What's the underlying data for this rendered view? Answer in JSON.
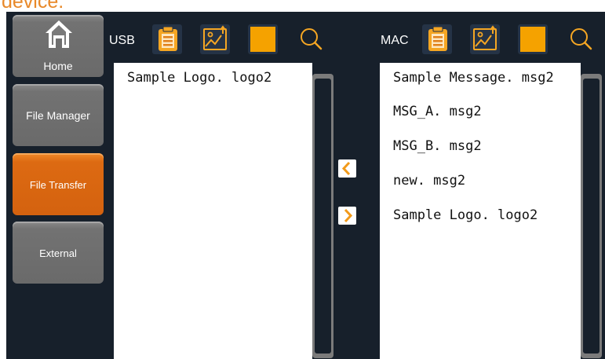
{
  "top_clipped_text": "device.",
  "nav": {
    "home": {
      "label": "Home",
      "icon": "home-icon"
    },
    "file_manager": {
      "label": "File Manager"
    },
    "file_transfer": {
      "label": "File Transfer",
      "active": true
    },
    "external": {
      "label": "External"
    }
  },
  "usb": {
    "label": "USB",
    "toolbar": [
      "message-list-icon",
      "logo-image-icon",
      "select-all-square-icon",
      "search-icon"
    ],
    "files": [
      "Sample Logo. logo2"
    ]
  },
  "mac": {
    "label": "MAC",
    "toolbar": [
      "message-list-icon",
      "logo-image-icon",
      "select-all-square-icon",
      "search-icon"
    ],
    "files": [
      "Sample Message. msg2",
      "MSG_A. msg2",
      "MSG_B. msg2",
      "new. msg2",
      "Sample Logo. logo2"
    ]
  },
  "transfer": {
    "to_usb_icon": "chevron-left-icon",
    "to_mac_icon": "chevron-right-icon"
  },
  "colors": {
    "background": "#17202b",
    "accent": "#d4620f",
    "icon_orange": "#f5a623",
    "nav_gray": "#6e6e6e"
  }
}
